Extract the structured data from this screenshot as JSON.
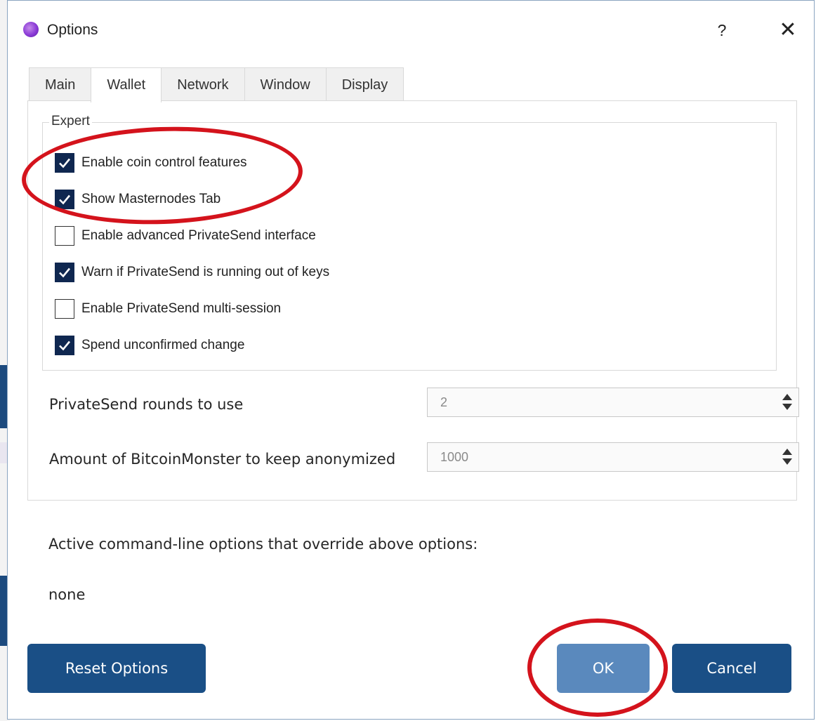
{
  "window": {
    "title": "Options",
    "help_label": "?",
    "close_label": "✕"
  },
  "tabs": [
    {
      "label": "Main",
      "active": false
    },
    {
      "label": "Wallet",
      "active": true
    },
    {
      "label": "Network",
      "active": false
    },
    {
      "label": "Window",
      "active": false
    },
    {
      "label": "Display",
      "active": false
    }
  ],
  "expert": {
    "group_title": "Expert",
    "options": [
      {
        "label": "Enable coin control features",
        "checked": true
      },
      {
        "label": "Show Masternodes Tab",
        "checked": true
      },
      {
        "label": "Enable advanced PrivateSend interface",
        "checked": false
      },
      {
        "label": "Warn if PrivateSend is running out of keys",
        "checked": true
      },
      {
        "label": "Enable PrivateSend multi-session",
        "checked": false
      },
      {
        "label": "Spend unconfirmed change",
        "checked": true
      }
    ]
  },
  "fields": {
    "rounds_label": "PrivateSend rounds to use",
    "rounds_value": "2",
    "amount_label": "Amount of BitcoinMonster to keep anonymized",
    "amount_value": "1000"
  },
  "override": {
    "text": "Active command-line options that override above options:",
    "value": "none"
  },
  "buttons": {
    "reset": "Reset Options",
    "ok": "OK",
    "cancel": "Cancel"
  },
  "colors": {
    "accent": "#1a4f86",
    "ok_button": "#5a89bd",
    "checkbox_checked": "#0f2750",
    "annotation_red": "#d4131c"
  }
}
